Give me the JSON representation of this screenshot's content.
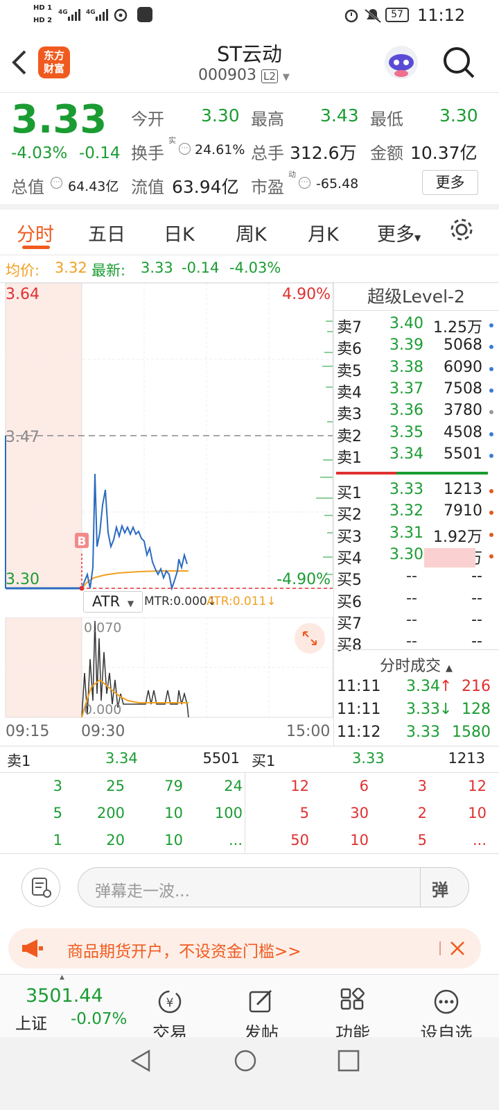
{
  "status": {
    "carriers": [
      "HD 1",
      "HD 2"
    ],
    "net": [
      "4G",
      "4G"
    ],
    "battery": "57",
    "time": "11:12"
  },
  "header": {
    "logo": [
      "东方",
      "财富"
    ],
    "title": "ST云动",
    "code": "000903",
    "level_badge": "L2"
  },
  "quote": {
    "price": "3.33",
    "pct": "-4.03%",
    "chg": "-0.14",
    "open_label": "今开",
    "open": "3.30",
    "high_label": "最高",
    "high": "3.43",
    "low_label": "最低",
    "low": "3.30",
    "turnover_label": "换手",
    "turnover_sup": "实",
    "turnover": "24.61%",
    "volume_label": "总手",
    "volume": "312.6万",
    "amount_label": "金额",
    "amount": "10.37亿",
    "mktcap_label": "总值",
    "mktcap": "64.43亿",
    "float_label": "流值",
    "float": "63.94亿",
    "pe_label": "市盈",
    "pe_sup": "动",
    "pe": "-65.48",
    "more": "更多"
  },
  "tabs": [
    "分时",
    "五日",
    "日K",
    "周K",
    "月K",
    "更多"
  ],
  "infoline": {
    "avg_label": "均价:",
    "avg": "3.32",
    "latest_label": "最新:",
    "latest": "3.33",
    "chg": "-0.14",
    "pct": "-4.03%"
  },
  "chart": {
    "y_high": "3.64",
    "y_mid": "3.47",
    "y_low": "3.30",
    "pct_high": "4.90%",
    "pct_low": "-4.90%",
    "b_marker": "B",
    "indicator": "ATR",
    "mtr": "MTR:0.000",
    "atr": "ATR:0.011",
    "ind_high": "0.070",
    "ind_low": "0.000",
    "times": [
      "09:15",
      "09:30",
      "15:00"
    ]
  },
  "level2": {
    "title": "超级Level-2",
    "asks": [
      {
        "label": "卖7",
        "price": "3.40",
        "vol": "1.25万"
      },
      {
        "label": "卖6",
        "price": "3.39",
        "vol": "5068"
      },
      {
        "label": "卖5",
        "price": "3.38",
        "vol": "6090"
      },
      {
        "label": "卖4",
        "price": "3.37",
        "vol": "7508"
      },
      {
        "label": "卖3",
        "price": "3.36",
        "vol": "3780"
      },
      {
        "label": "卖2",
        "price": "3.35",
        "vol": "4508"
      },
      {
        "label": "卖1",
        "price": "3.34",
        "vol": "5501"
      }
    ],
    "bids": [
      {
        "label": "买1",
        "price": "3.33",
        "vol": "1213"
      },
      {
        "label": "买2",
        "price": "3.32",
        "vol": "7910"
      },
      {
        "label": "买3",
        "price": "3.31",
        "vol": "1.92万"
      },
      {
        "label": "买4",
        "price": "3.30",
        "vol": "12.49万"
      },
      {
        "label": "买5",
        "price": "--",
        "vol": "--"
      },
      {
        "label": "买6",
        "price": "--",
        "vol": "--"
      },
      {
        "label": "买7",
        "price": "--",
        "vol": "--"
      },
      {
        "label": "买8",
        "price": "--",
        "vol": "--"
      }
    ],
    "trades_title": "分时成交",
    "trades": [
      {
        "time": "11:11",
        "price": "3.34",
        "arrow": "↑",
        "vol": "216"
      },
      {
        "time": "11:11",
        "price": "3.33",
        "arrow": "↓",
        "vol": "128"
      },
      {
        "time": "11:12",
        "price": "3.33",
        "arrow": "",
        "vol": "1580"
      }
    ]
  },
  "queue": {
    "sell_label": "卖1",
    "sell_price": "3.34",
    "sell_vol": "5501",
    "buy_label": "买1",
    "buy_price": "3.33",
    "buy_vol": "1213",
    "sell_rows": [
      [
        "3",
        "25",
        "79",
        "24"
      ],
      [
        "5",
        "200",
        "10",
        "100"
      ],
      [
        "1",
        "20",
        "10",
        "..."
      ]
    ],
    "buy_rows": [
      [
        "12",
        "6",
        "3",
        "12"
      ],
      [
        "5",
        "30",
        "2",
        "10"
      ],
      [
        "50",
        "10",
        "5",
        "..."
      ]
    ]
  },
  "comment": {
    "placeholder": "弹幕走一波...",
    "danmu": "弹"
  },
  "banner": {
    "text": "商品期货开户，不设资金门槛>>"
  },
  "bottom": {
    "index_value": "3501.44",
    "index_name": "上证",
    "index_pct": "-0.07%",
    "nav": [
      "交易",
      "发帖",
      "功能",
      "设自选"
    ]
  },
  "colors": {
    "up": "#e03030",
    "down": "#1a9c32",
    "avg": "#f0a020",
    "price_line": "#2a6bbf",
    "accent": "#f05a1e"
  }
}
